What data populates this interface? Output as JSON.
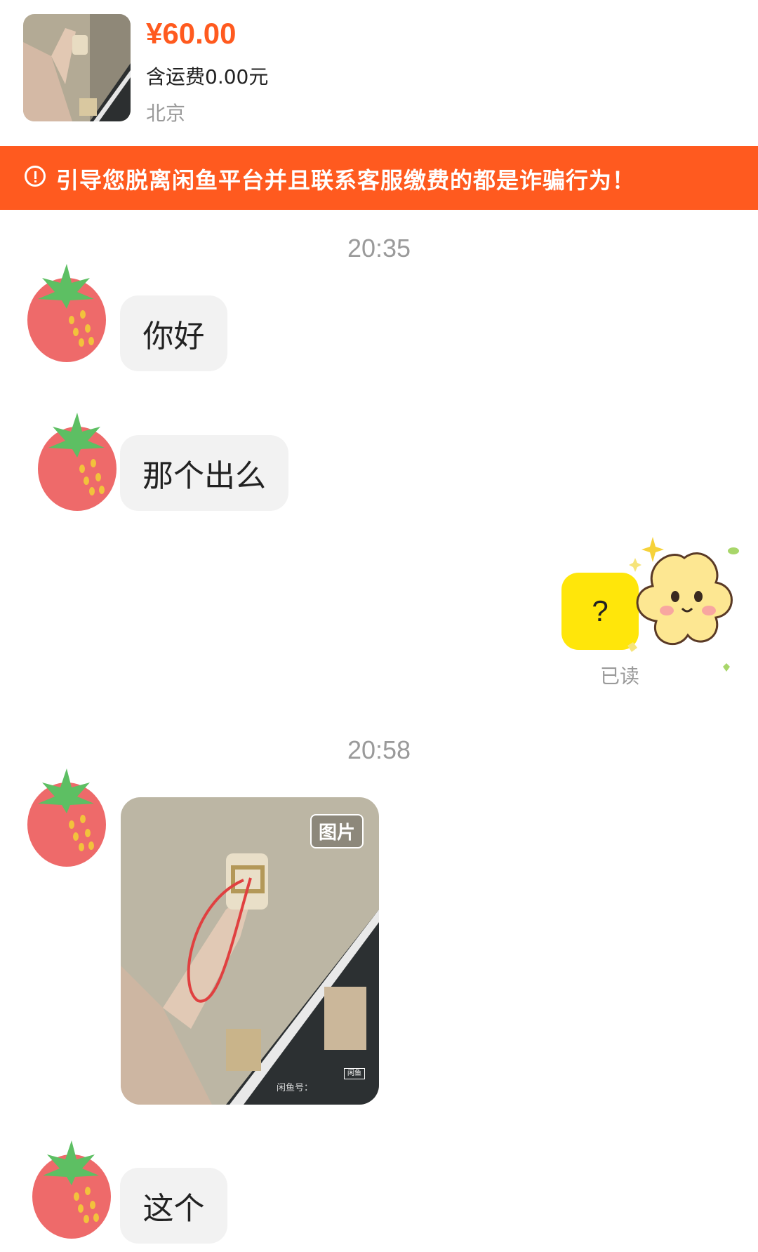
{
  "product": {
    "price": "¥60.00",
    "shipping": "含运费0.00元",
    "location": "北京"
  },
  "warning": {
    "text": "引导您脱离闲鱼平台并且联系客服缴费的都是诈骗行为！",
    "icon": "warning-circle-icon"
  },
  "chat": {
    "timestamps": [
      "20:35",
      "20:58"
    ],
    "messages": [
      {
        "from": "other",
        "type": "text",
        "text": "你好"
      },
      {
        "from": "other",
        "type": "text",
        "text": "那个出么"
      },
      {
        "from": "me",
        "type": "text",
        "text": "?",
        "status": "已读"
      },
      {
        "from": "other",
        "type": "image",
        "tag": "图片",
        "watermark": "闲鱼号：",
        "logo": "闲鱼"
      },
      {
        "from": "other",
        "type": "text",
        "text": "这个"
      }
    ]
  },
  "colors": {
    "accent": "#ff5a1f",
    "bubble_in": "#f2f2f2",
    "bubble_out": "#ffe60a",
    "muted_text": "#9a9a9a"
  }
}
